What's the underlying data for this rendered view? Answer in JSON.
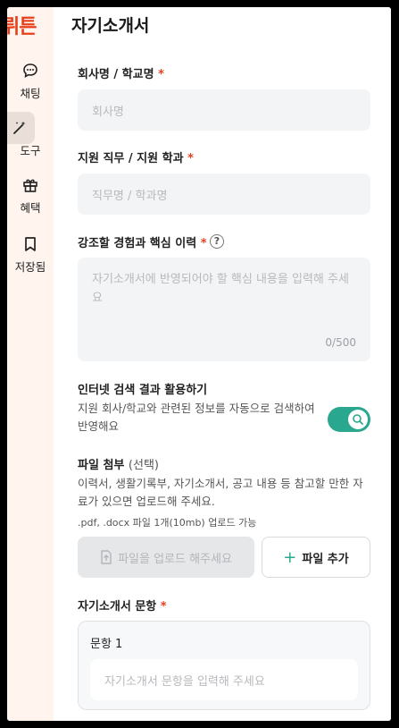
{
  "app": {
    "brand": "뤼튼"
  },
  "sidebar": {
    "items": [
      {
        "label": "채팅",
        "icon": "chat-icon"
      },
      {
        "label": "도구",
        "icon": "magic-wand-icon",
        "active": true
      },
      {
        "label": "혜택",
        "icon": "gift-icon"
      },
      {
        "label": "저장됨",
        "icon": "bookmark-icon"
      }
    ]
  },
  "page": {
    "title": "자기소개서"
  },
  "form": {
    "company": {
      "label": "회사명 / 학교명",
      "required_mark": "*",
      "placeholder": "회사명"
    },
    "position": {
      "label": "지원 직무 / 지원 학과",
      "required_mark": "*",
      "placeholder": "직무명 / 학과명"
    },
    "experience": {
      "label": "강조할 경험과 핵심 이력",
      "required_mark": "*",
      "help": "?",
      "placeholder": "자기소개서에 반영되어야 할 핵심 내용을 입력해 주세요",
      "counter": "0/500"
    },
    "web_search": {
      "label": "인터넷 검색 결과 활용하기",
      "description": "지원 회사/학교와 관련된 정보를 자동으로 검색하여 반영해요",
      "enabled": true,
      "icon": "search-icon"
    },
    "attachment": {
      "label": "파일 첨부",
      "optional": "(선택)",
      "description": "이력서, 생활기록부, 자기소개서, 공고 내용 등 참고할 만한 자료가 있으면 업로드해 주세요.",
      "note": ".pdf, .docx 파일 1개(10mb) 업로드 가능",
      "upload_placeholder": "파일을 업로드 해주세요",
      "add_label": "파일 추가",
      "add_icon": "+"
    },
    "questions": {
      "label": "자기소개서 문항",
      "required_mark": "*",
      "items": [
        {
          "title": "문항 1",
          "placeholder": "자기소개서 문항을 입력해 주세요"
        }
      ]
    }
  },
  "colors": {
    "brand": "#e8401c",
    "accent": "#2aa88f",
    "sidebar_bg": "#fff4ee"
  }
}
